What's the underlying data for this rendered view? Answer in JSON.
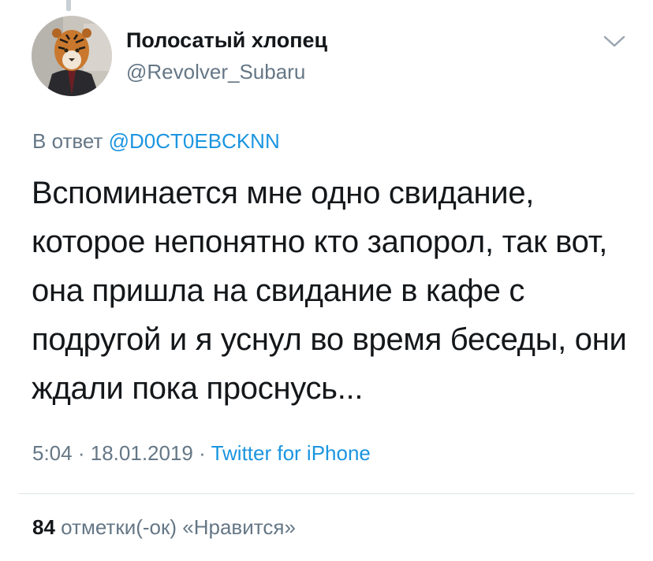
{
  "tweet": {
    "author": {
      "display_name": "Полосатый хлопец",
      "handle": "@Revolver_Subaru"
    },
    "reply_prefix": "В ответ",
    "reply_to": "@D0CT0EBCKNN",
    "text": "Вспоминается мне одно свидание, которое непонятно кто запорол, так вот, она пришла на свидание в кафе с подругой и я уснул во время беседы, они ждали пока проснусь...",
    "time": "5:04",
    "separator": "·",
    "date": "18.01.2019",
    "source": "Twitter for iPhone",
    "likes_count": "84",
    "likes_label": "отметки(-ок) «Нравится»"
  },
  "icons": {
    "menu": "chevron-down-icon",
    "avatar": "tiger-avatar"
  },
  "colors": {
    "link": "#1b95e0",
    "secondary_text": "#657786",
    "primary_text": "#14171a",
    "divider": "#dde3e8"
  }
}
